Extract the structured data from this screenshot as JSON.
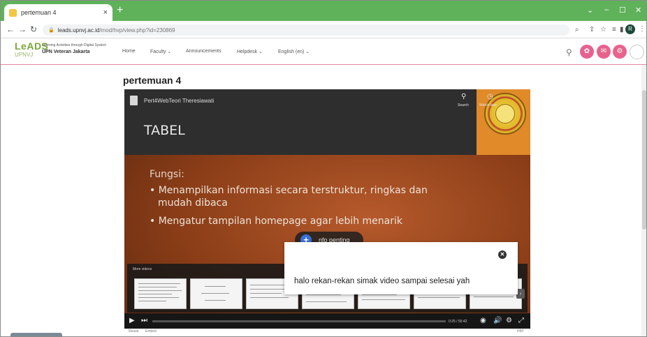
{
  "browser": {
    "tab_title": "pertemuan 4",
    "tab_close": "×",
    "new_tab": "+",
    "win_min": "–",
    "win_max": "☐",
    "win_close": "✕",
    "chevron": "⌄",
    "url_domain": "leads.upnvj.ac.id",
    "url_path": "/mod/hvp/view.php?id=230869",
    "profile_initial": "R"
  },
  "site": {
    "logo_text": "LeADS",
    "logo_sub": "UPNVJ",
    "logo_desc": "Learning Activities through Digital System",
    "logo_name": "UPN Veteran Jakarta",
    "menu": [
      "Home",
      "Faculty ⌄",
      "Announcements",
      "Helpdesk ⌄",
      "English (en) ⌄"
    ]
  },
  "page": {
    "title": "pertemuan 4"
  },
  "video": {
    "title": "Pert4WebTeori Theresiawati",
    "top_search_label": "Search",
    "top_watch_label": "Watch later",
    "slide_heading": "TABEL",
    "slide_sub": "Fungsi:",
    "bullets": [
      "• Menampilkan informasi secara terstruktur, ringkas dan",
      "mudah dibaca",
      "• Mengatur tampilan homepage agar lebih menarik"
    ],
    "info_label": "nfo penting",
    "more_videos_label": "More videos",
    "timecode": "0:25 / 55:42",
    "below_left": "Reuse",
    "below_embed": "Embed",
    "below_right": "H5P"
  },
  "popup": {
    "message": "halo rekan-rekan simak video sampai selesai yah",
    "close_icon": "✕"
  },
  "colors": {
    "tabstrip": "#5fb25a",
    "accent_pink": "#e7628d",
    "slide_orange": "#b65a2c"
  }
}
